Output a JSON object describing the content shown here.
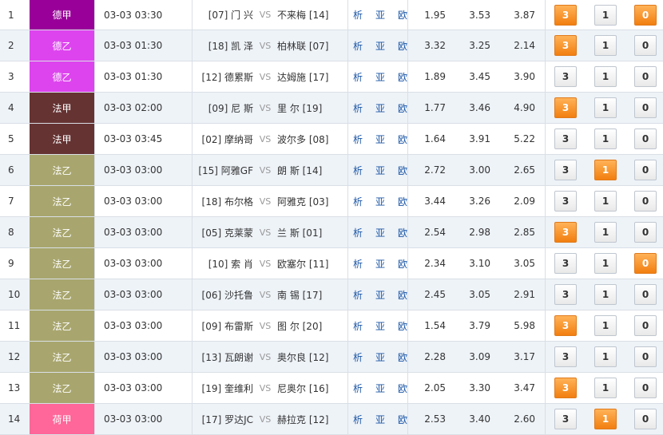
{
  "rows": [
    {
      "idx": "1",
      "league": "德甲",
      "league_color": "#990099",
      "time": "03-03 03:30",
      "home": "[07] 门 兴",
      "away": "不来梅 [14]",
      "odds": [
        "1.95",
        "3.53",
        "3.87"
      ],
      "sel": [
        true,
        false,
        true
      ]
    },
    {
      "idx": "2",
      "league": "德乙",
      "league_color": "#dd44ee",
      "time": "03-03 01:30",
      "home": "[18] 凯 泽",
      "away": "柏林联 [07]",
      "odds": [
        "3.32",
        "3.25",
        "2.14"
      ],
      "sel": [
        true,
        false,
        false
      ]
    },
    {
      "idx": "3",
      "league": "德乙",
      "league_color": "#dd44ee",
      "time": "03-03 01:30",
      "home": "[12] 德累斯",
      "away": "达姆施 [17]",
      "odds": [
        "1.89",
        "3.45",
        "3.90"
      ],
      "sel": [
        false,
        false,
        false
      ]
    },
    {
      "idx": "4",
      "league": "法甲",
      "league_color": "#663333",
      "time": "03-03 02:00",
      "home": "[09] 尼 斯",
      "away": "里 尔 [19]",
      "odds": [
        "1.77",
        "3.46",
        "4.90"
      ],
      "sel": [
        true,
        false,
        false
      ]
    },
    {
      "idx": "5",
      "league": "法甲",
      "league_color": "#663333",
      "time": "03-03 03:45",
      "home": "[02] 摩纳哥",
      "away": "波尔多 [08]",
      "odds": [
        "1.64",
        "3.91",
        "5.22"
      ],
      "sel": [
        false,
        false,
        false
      ]
    },
    {
      "idx": "6",
      "league": "法乙",
      "league_color": "#a8a66e",
      "time": "03-03 03:00",
      "home": "[15] 阿雅GF",
      "away": "朗 斯 [14]",
      "odds": [
        "2.72",
        "3.00",
        "2.65"
      ],
      "sel": [
        false,
        true,
        false
      ]
    },
    {
      "idx": "7",
      "league": "法乙",
      "league_color": "#a8a66e",
      "time": "03-03 03:00",
      "home": "[18] 布尔格",
      "away": "阿雅克 [03]",
      "odds": [
        "3.44",
        "3.26",
        "2.09"
      ],
      "sel": [
        false,
        false,
        false
      ]
    },
    {
      "idx": "8",
      "league": "法乙",
      "league_color": "#a8a66e",
      "time": "03-03 03:00",
      "home": "[05] 克莱蒙",
      "away": "兰 斯 [01]",
      "odds": [
        "2.54",
        "2.98",
        "2.85"
      ],
      "sel": [
        true,
        false,
        false
      ]
    },
    {
      "idx": "9",
      "league": "法乙",
      "league_color": "#a8a66e",
      "time": "03-03 03:00",
      "home": "[10] 索 肖",
      "away": "欧塞尔 [11]",
      "odds": [
        "2.34",
        "3.10",
        "3.05"
      ],
      "sel": [
        false,
        false,
        true
      ]
    },
    {
      "idx": "10",
      "league": "法乙",
      "league_color": "#a8a66e",
      "time": "03-03 03:00",
      "home": "[06] 沙托鲁",
      "away": "南 锡 [17]",
      "odds": [
        "2.45",
        "3.05",
        "2.91"
      ],
      "sel": [
        false,
        false,
        false
      ]
    },
    {
      "idx": "11",
      "league": "法乙",
      "league_color": "#a8a66e",
      "time": "03-03 03:00",
      "home": "[09] 布雷斯",
      "away": "图 尔 [20]",
      "odds": [
        "1.54",
        "3.79",
        "5.98"
      ],
      "sel": [
        true,
        false,
        false
      ]
    },
    {
      "idx": "12",
      "league": "法乙",
      "league_color": "#a8a66e",
      "time": "03-03 03:00",
      "home": "[13] 瓦朗谢",
      "away": "奥尔良 [12]",
      "odds": [
        "2.28",
        "3.09",
        "3.17"
      ],
      "sel": [
        false,
        false,
        false
      ]
    },
    {
      "idx": "13",
      "league": "法乙",
      "league_color": "#a8a66e",
      "time": "03-03 03:00",
      "home": "[19] 奎维利",
      "away": "尼奥尔 [16]",
      "odds": [
        "2.05",
        "3.30",
        "3.47"
      ],
      "sel": [
        true,
        false,
        false
      ]
    },
    {
      "idx": "14",
      "league": "荷甲",
      "league_color": "#ff6699",
      "time": "03-03 03:00",
      "home": "[17] 罗达JC",
      "away": "赫拉克 [12]",
      "odds": [
        "2.53",
        "3.40",
        "2.60"
      ],
      "sel": [
        false,
        true,
        false
      ]
    }
  ],
  "labels": {
    "vs": "VS",
    "xi": "析",
    "ya": "亚",
    "ou": "欧",
    "p3": "3",
    "p1": "1",
    "p0": "0"
  }
}
